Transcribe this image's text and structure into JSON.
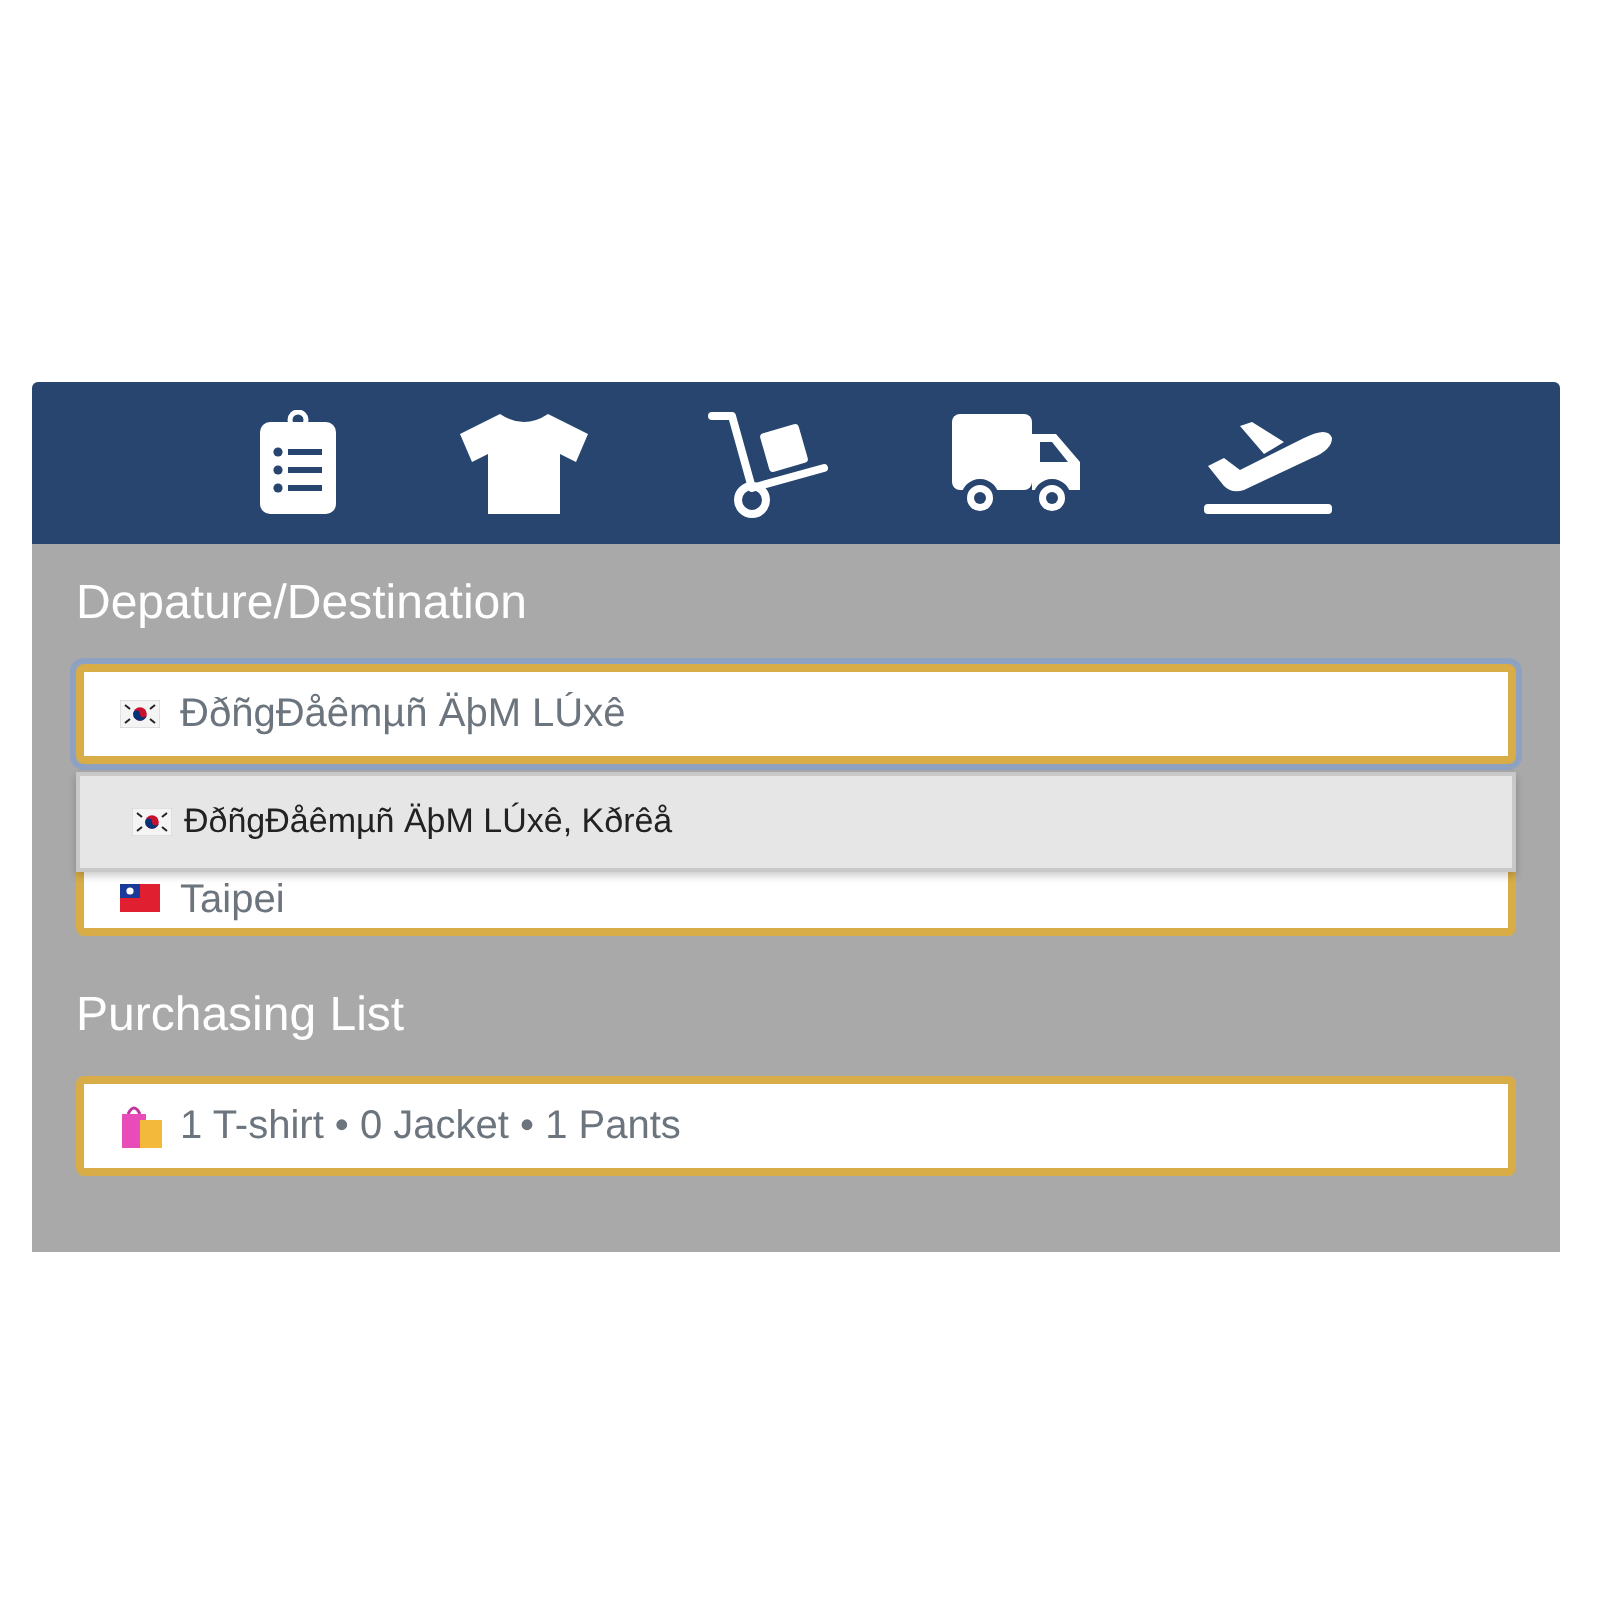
{
  "sections": [
    {
      "heading": "Depature/Destination",
      "fields": [
        {
          "kind": "location",
          "value": "ĐðñgĐåêmµñ ÄþM LÚxê",
          "focused": true
        },
        {
          "kind": "location",
          "value": "Taipei",
          "focused": false
        }
      ],
      "dropdown": {
        "options": [
          {
            "text": "ĐðñgĐåêmµñ ÄþM LÚxê, Kðrêå"
          }
        ]
      }
    },
    {
      "heading": "Purchasing List",
      "fields": [
        {
          "kind": "list",
          "value": "1 T-shirt • 0 Jacket • 1 Pants",
          "focused": false
        }
      ]
    }
  ]
}
